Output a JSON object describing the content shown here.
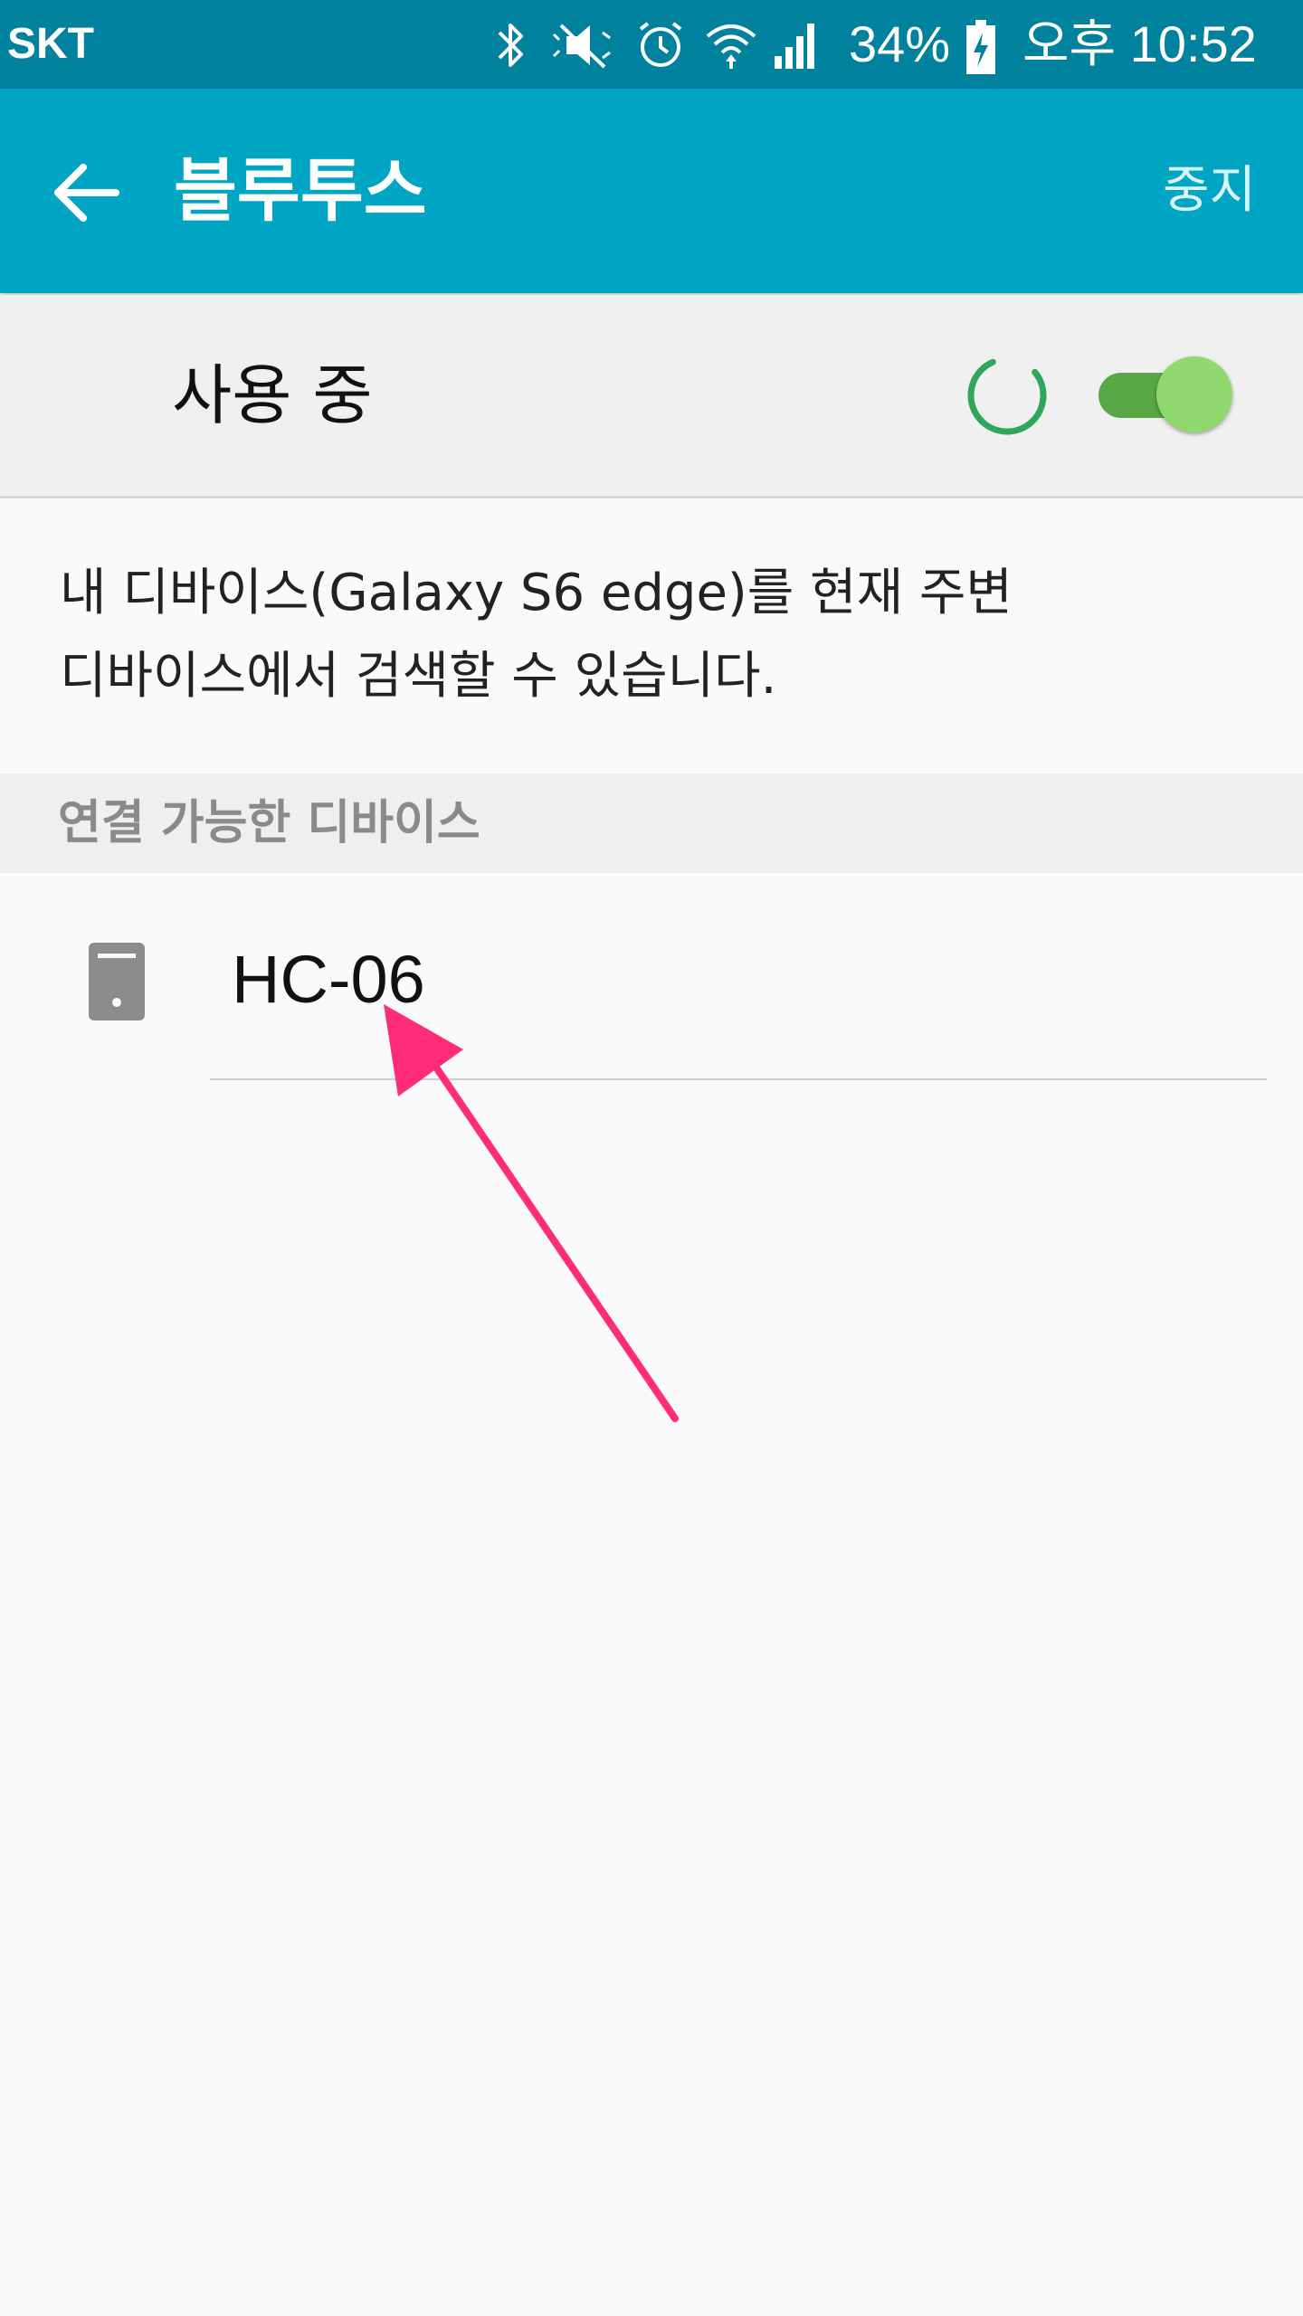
{
  "status_bar": {
    "carrier": "SKT",
    "battery": "34%",
    "time": "오후 10:52",
    "icons": [
      "bluetooth-icon",
      "mute-icon",
      "alarm-icon",
      "wifi-icon",
      "signal-icon",
      "battery-charging-icon"
    ]
  },
  "app_bar": {
    "title": "블루투스",
    "stop_label": "중지",
    "back_icon": "arrow-back-icon"
  },
  "master_switch": {
    "label": "사용 중",
    "state": "on",
    "scanning": true
  },
  "description": {
    "line1": "내 디바이스(Galaxy S6 edge)를 현재 주변",
    "line2": "디바이스에서 검색할 수 있습니다."
  },
  "available_devices": {
    "header": "연결 가능한 디바이스",
    "items": [
      {
        "name": "HC-06",
        "icon": "device-icon"
      }
    ]
  },
  "colors": {
    "status_bar": "#00819e",
    "app_bar": "#00a5c4",
    "switch_on": "#58a845",
    "annotation_arrow": "#ff2d78"
  }
}
